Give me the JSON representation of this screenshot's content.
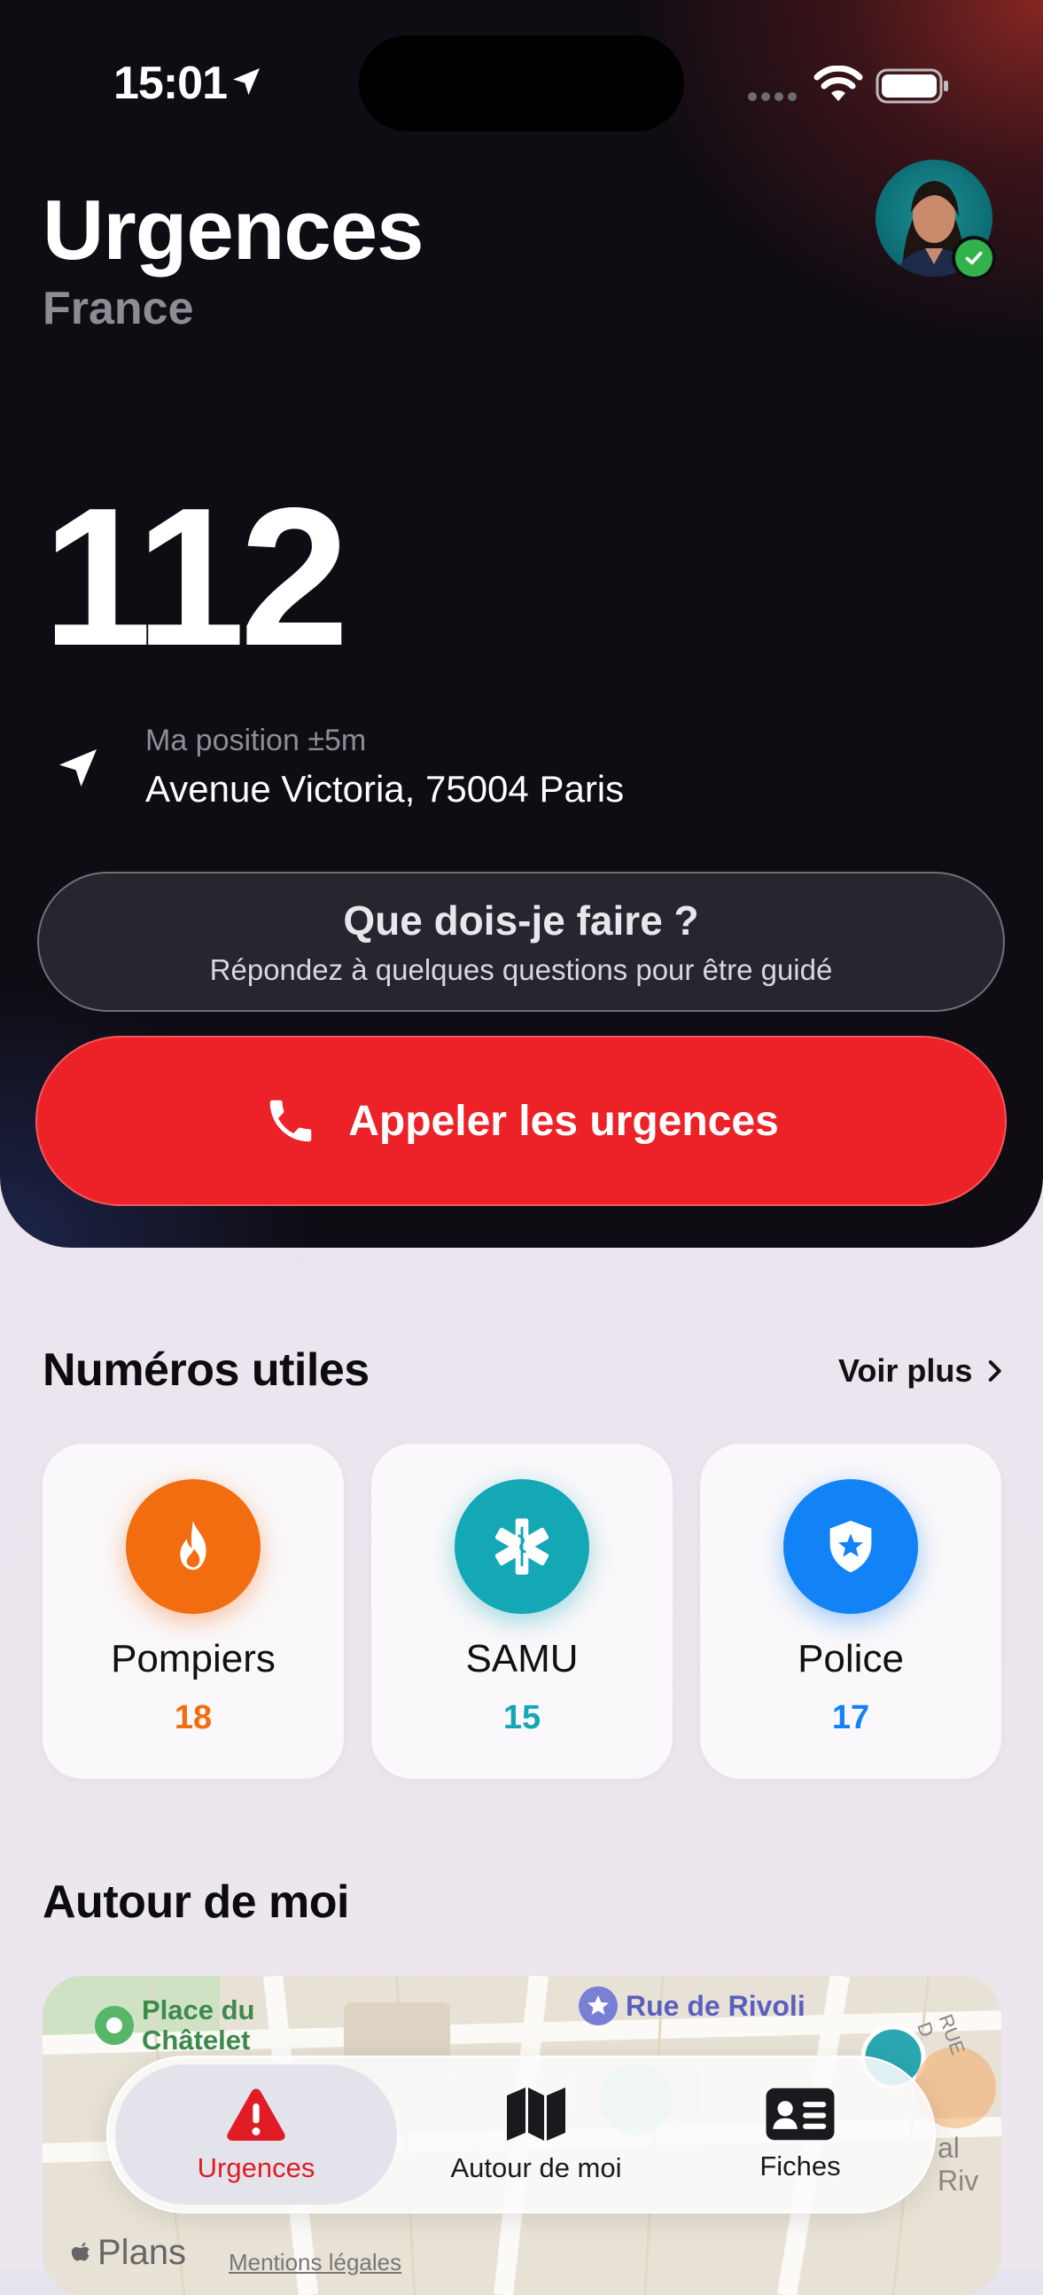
{
  "status_bar": {
    "time": "15:01"
  },
  "header": {
    "title": "Urgences",
    "subtitle": "France"
  },
  "emergency": {
    "number": "112"
  },
  "location": {
    "label": "Ma position ±5m",
    "address": "Avenue Victoria, 75004 Paris"
  },
  "guide_button": {
    "title": "Que dois-je faire ?",
    "subtitle": "Répondez à quelques questions pour être guidé"
  },
  "call_button": {
    "label": "Appeler les urgences"
  },
  "useful_numbers": {
    "title": "Numéros utiles",
    "more": "Voir plus",
    "items": [
      {
        "name": "Pompiers",
        "number": "18",
        "icon": "fire-icon",
        "color": "#f26d0f"
      },
      {
        "name": "SAMU",
        "number": "15",
        "icon": "medical-star-icon",
        "color": "#14a7b6"
      },
      {
        "name": "Police",
        "number": "17",
        "icon": "police-badge-icon",
        "color": "#1282f7"
      }
    ]
  },
  "nearby": {
    "title": "Autour de moi",
    "map": {
      "places": [
        "Place du Châtelet",
        "Rue de Rivoli",
        "RUE D",
        "al Riv"
      ],
      "attribution": "Plans",
      "legal": "Mentions légales"
    }
  },
  "tabs": [
    {
      "label": "Urgences",
      "icon": "warning-icon",
      "active": true
    },
    {
      "label": "Autour de moi",
      "icon": "map-icon",
      "active": false
    },
    {
      "label": "Fiches",
      "icon": "id-card-icon",
      "active": false
    }
  ],
  "colors": {
    "accent": "#ec2228",
    "fire": "#f26d0f",
    "samu": "#14a7b6",
    "police": "#1282f7",
    "verified": "#32b24a"
  }
}
